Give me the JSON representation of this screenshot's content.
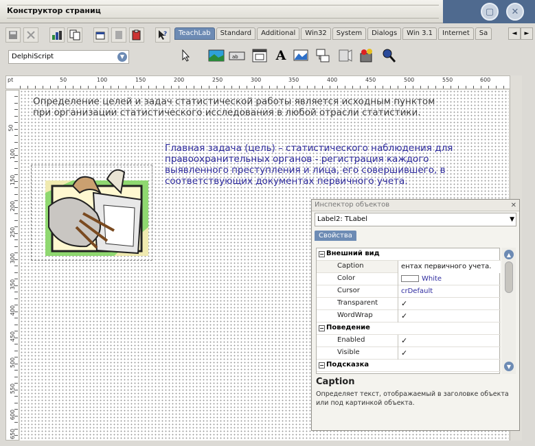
{
  "window": {
    "title": "Конструктор страниц"
  },
  "window_buttons": {
    "maximize_glyph": "▢",
    "close_glyph": "✕"
  },
  "toolbar": {
    "buttons": [
      "save-icon",
      "cut-icon",
      "chart-icon",
      "copy-icon",
      "properties-icon",
      "new-icon",
      "paste-icon",
      "help-icon"
    ]
  },
  "palette": {
    "tabs": [
      "TeachLab",
      "Standard",
      "Additional",
      "Win32",
      "System",
      "Dialogs",
      "Win 3.1",
      "Internet",
      "Sa"
    ],
    "active_tab": "TeachLab",
    "nav_left": "◄",
    "nav_right": "►",
    "language": "DelphiScript",
    "components": [
      "pointer-icon",
      "image-icon",
      "button-icon",
      "window-icon",
      "label-icon",
      "picture-icon",
      "link-icon",
      "media-icon",
      "shape-icon",
      "search-icon"
    ],
    "label_glyph": "A"
  },
  "ruler": {
    "unit": "pt",
    "marks": [
      "50",
      "100",
      "150",
      "200",
      "250",
      "300",
      "350",
      "400",
      "450",
      "500",
      "550",
      "600"
    ],
    "vmarks": [
      "50",
      "100",
      "150",
      "200",
      "250",
      "300",
      "350",
      "400",
      "450",
      "500",
      "550",
      "600",
      "650"
    ]
  },
  "page": {
    "label1": "Определение целей и задач статистической работы является исходным пунктом при организации статистического исследования в любой отрасли статистики.",
    "label2": "Главная задача (цель) – статистического наблюдения для правоохранительных органов - регистрация каждого выявленного преступления и лица, его совершившего, в соответствующих документах первичного учета."
  },
  "inspector": {
    "title": "Инспектор объектов",
    "object": "Label2: TLabel",
    "tab": "Свойства",
    "categories": [
      {
        "name": "Внешний вид",
        "props": [
          {
            "name": "Caption",
            "value": "ентах первичного учета."
          },
          {
            "name": "Color",
            "value": "White"
          },
          {
            "name": "Cursor",
            "value": "crDefault"
          },
          {
            "name": "Transparent",
            "value": "✓"
          },
          {
            "name": "WordWrap",
            "value": "✓"
          }
        ]
      },
      {
        "name": "Поведение",
        "props": [
          {
            "name": "Enabled",
            "value": "✓"
          },
          {
            "name": "Visible",
            "value": "✓"
          }
        ]
      },
      {
        "name": "Подсказка",
        "props": []
      }
    ],
    "desc_title": "Caption",
    "desc_text": "Определяет текст, отображаемый в заголовке объекта или под картинкой объекта."
  }
}
